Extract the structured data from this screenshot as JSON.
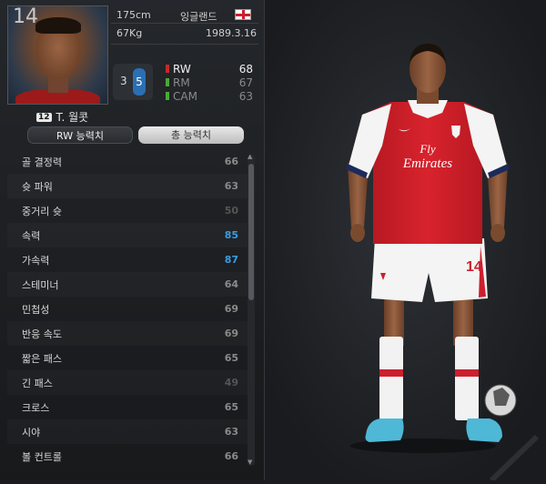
{
  "player": {
    "number": "14",
    "name_badge": "12",
    "name": "T. 월콧",
    "height": "175cm",
    "weight": "67Kg",
    "nationality": "잉글랜드",
    "birthdate": "1989.3.16",
    "foot_left": "3",
    "foot_right": "5"
  },
  "positions": [
    {
      "name": "RW",
      "value": "68",
      "color": "#c42a2a"
    },
    {
      "name": "RM",
      "value": "67",
      "color": "#4aa83a"
    },
    {
      "name": "CAM",
      "value": "63",
      "color": "#4aa83a"
    }
  ],
  "tabs": {
    "rw_label": "RW 능력치",
    "total_label": "총 능력치"
  },
  "stats": [
    {
      "label": "골 결정력",
      "value": "66",
      "color": "#8a8a8a"
    },
    {
      "label": "슛 파워",
      "value": "63",
      "color": "#8a8a8a"
    },
    {
      "label": "중거리 슛",
      "value": "50",
      "color": "#555555"
    },
    {
      "label": "속력",
      "value": "85",
      "color": "#3d9be0"
    },
    {
      "label": "가속력",
      "value": "87",
      "color": "#3d9be0"
    },
    {
      "label": "스테미너",
      "value": "64",
      "color": "#8a8a8a"
    },
    {
      "label": "민첩성",
      "value": "69",
      "color": "#8a8a8a"
    },
    {
      "label": "반응 속도",
      "value": "69",
      "color": "#8a8a8a"
    },
    {
      "label": "짧은 패스",
      "value": "65",
      "color": "#8a8a8a"
    },
    {
      "label": "긴 패스",
      "value": "49",
      "color": "#555555"
    },
    {
      "label": "크로스",
      "value": "65",
      "color": "#8a8a8a"
    },
    {
      "label": "시야",
      "value": "63",
      "color": "#8a8a8a"
    },
    {
      "label": "볼 컨트롤",
      "value": "66",
      "color": "#8a8a8a"
    }
  ],
  "kit": {
    "sponsor_line1": "Fly",
    "sponsor_line2": "Emirates",
    "shorts_number": "14",
    "shirt_color": "#d2202a",
    "sleeve_color": "#ffffff"
  }
}
